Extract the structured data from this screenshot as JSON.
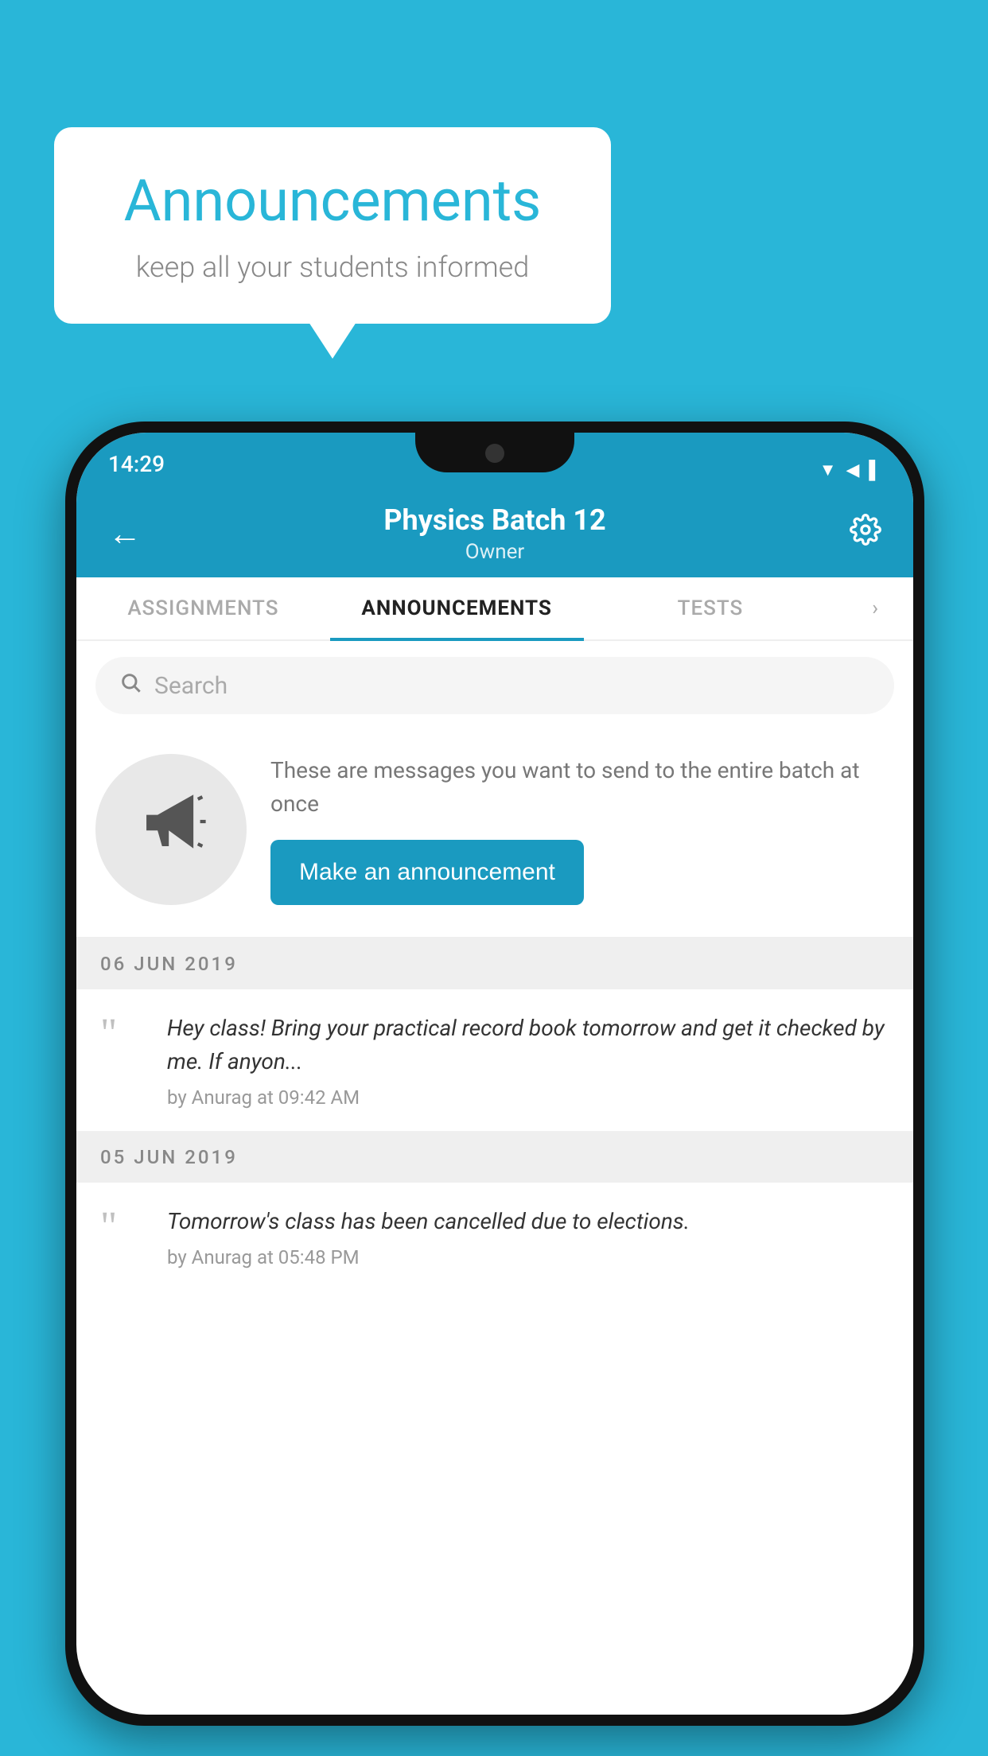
{
  "page": {
    "background_color": "#29b6d8"
  },
  "speech_bubble": {
    "title": "Announcements",
    "subtitle": "keep all your students informed"
  },
  "status_bar": {
    "time": "14:29",
    "signal_icon": "▼◀",
    "battery_icon": "🔋"
  },
  "header": {
    "back_label": "←",
    "title": "Physics Batch 12",
    "subtitle": "Owner",
    "gear_label": "⚙"
  },
  "tabs": [
    {
      "label": "ASSIGNMENTS",
      "active": false
    },
    {
      "label": "ANNOUNCEMENTS",
      "active": true
    },
    {
      "label": "TESTS",
      "active": false
    }
  ],
  "search": {
    "placeholder": "Search"
  },
  "promo": {
    "description": "These are messages you want to send to the entire batch at once",
    "button_label": "Make an announcement"
  },
  "announcements": [
    {
      "date": "06  JUN  2019",
      "text": "Hey class! Bring your practical record book tomorrow and get it checked by me. If anyon...",
      "meta": "by Anurag at 09:42 AM"
    },
    {
      "date": "05  JUN  2019",
      "text": "Tomorrow's class has been cancelled due to elections.",
      "meta": "by Anurag at 05:48 PM"
    }
  ]
}
